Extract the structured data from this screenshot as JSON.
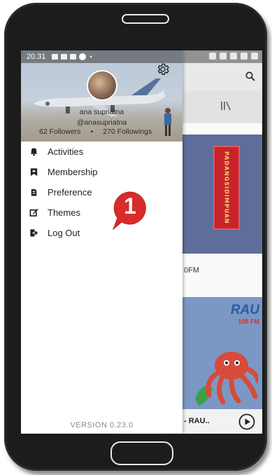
{
  "status_bar": {
    "time": "20.31"
  },
  "profile": {
    "name": "ana supriatna",
    "handle": "@anasupriatna",
    "followers": "62 Followers",
    "separator": "•",
    "followings": "270 Followings"
  },
  "menu": {
    "items": [
      {
        "label": "Activities",
        "icon": "bell-icon"
      },
      {
        "label": "Membership",
        "icon": "bookmark-icon"
      },
      {
        "label": "Preference",
        "icon": "preference-icon"
      },
      {
        "label": "Themes",
        "icon": "themes-icon"
      },
      {
        "label": "Log Out",
        "icon": "logout-icon"
      }
    ]
  },
  "footer": {
    "version": "VERSION 0.23.0"
  },
  "annotation": {
    "badge_number": "1",
    "color": "#d92b2b"
  },
  "background_app": {
    "banner_text": "PADANGSIDIMPUAN",
    "station_label_fragment": "0FM",
    "logo_text": "RAU",
    "logo_sub": "105 FM",
    "now_playing": "- RAU.."
  },
  "colors": {
    "drawer_bg": "#ffffff",
    "header_overlay": "#c5d0dc",
    "badge": "#d92b2b"
  }
}
